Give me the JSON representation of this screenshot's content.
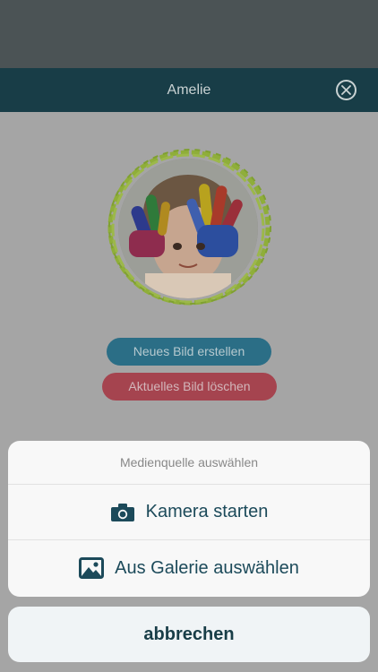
{
  "header": {
    "title": "Amelie"
  },
  "profile": {
    "new_image_label": "Neues Bild erstellen",
    "delete_image_label": "Aktuelles Bild löschen"
  },
  "action_sheet": {
    "title": "Medienquelle auswählen",
    "options": [
      {
        "label": "Kamera starten",
        "icon": "camera-icon"
      },
      {
        "label": "Aus Galerie auswählen",
        "icon": "image-icon"
      }
    ],
    "cancel_label": "abbrechen"
  },
  "colors": {
    "header_bg": "#183d47",
    "primary_button": "#2b6e86",
    "danger_button": "#a5444f",
    "accent_ring": "#8fae3a",
    "sheet_text": "#1c4a5a"
  }
}
